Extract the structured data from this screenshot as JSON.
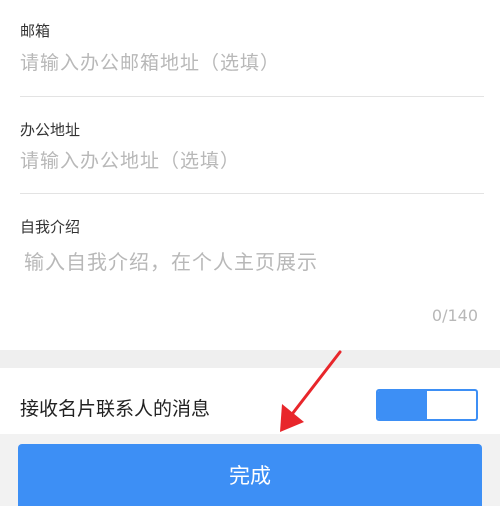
{
  "form": {
    "email": {
      "label": "邮箱",
      "placeholder": "请输入办公邮箱地址（选填）"
    },
    "office_address": {
      "label": "办公地址",
      "placeholder": "请输入办公地址（选填）"
    },
    "intro": {
      "label": "自我介绍",
      "placeholder": "输入自我介绍，在个人主页展示",
      "counter": "0/140"
    }
  },
  "settings": {
    "receive_messages_label": "接收名片联系人的消息",
    "receive_messages_enabled": true,
    "toggle_fill_fraction": 0.5
  },
  "actions": {
    "done_label": "完成"
  },
  "colors": {
    "accent": "#3d8ff5",
    "arrow": "#e8262b"
  }
}
